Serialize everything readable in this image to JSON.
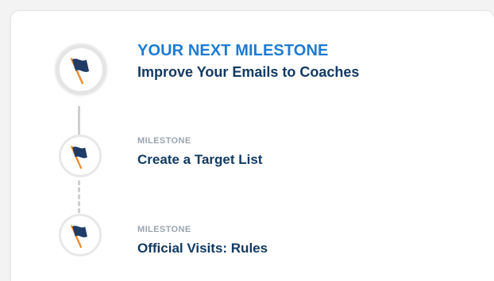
{
  "next_milestone": {
    "heading": "YOUR NEXT MILESTONE",
    "title": "Improve Your Emails to Coaches",
    "icon": "flag-icon"
  },
  "milestones": [
    {
      "label": "MILESTONE",
      "title": "Create a Target List",
      "icon": "flag-icon"
    },
    {
      "label": "MILESTONE",
      "title": "Official Visits: Rules",
      "icon": "flag-icon"
    }
  ],
  "colors": {
    "heading_blue": "#1f7bd1",
    "title_navy": "#123a63",
    "label_gray": "#9aa4ae",
    "flag_navy": "#1f3b66",
    "flag_pole_orange": "#f08b2c",
    "rail_gray": "#cfcfcf"
  }
}
